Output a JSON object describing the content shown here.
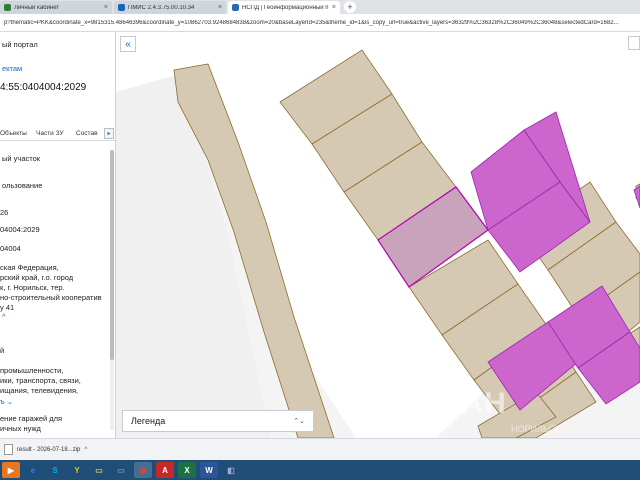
{
  "browser": {
    "tabs": [
      {
        "label": "Личный кабинет",
        "favicon_color": "#2e7d32",
        "active": false
      },
      {
        "label": "ПМИС 2.4.3.75.00.10.34",
        "favicon_color": "#1565c0",
        "active": false
      },
      {
        "label": "НСПД | Геоинформационный п",
        "favicon_color": "#2b6cb0",
        "active": true
      }
    ],
    "new_tab_glyph": "+",
    "close_glyph": "×",
    "address": "p?thematic=PKK&coordinate_x=9815315.48646396&coordinate_y=10862703.9248684838&zoom=20&baseLayerId=235&theme_id=1&is_copy_url=true&active_layers=36329%2C36328%2C36049%2C36048&selectedCard=1682..."
  },
  "panel": {
    "portal_title": "ый портал",
    "layers_link": "ектам",
    "cadastral_number": "4:55:0404004:2029",
    "subtabs": [
      "Объекты",
      "Части ЗУ",
      "Состав"
    ],
    "subtab_arrow": "▸",
    "lines": [
      {
        "text": "ый участок",
        "style": "normal"
      },
      {
        "text": "ользование",
        "style": "normal"
      },
      {
        "text": "26",
        "style": "normal"
      },
      {
        "text": "04004:2029",
        "style": "normal"
      },
      {
        "text": "04004",
        "style": "normal"
      },
      {
        "text": "ская Федерация,",
        "style": "normal"
      },
      {
        "text": "рский край, г.о. город",
        "style": "normal"
      },
      {
        "text": "к, г. Норильск, тер.",
        "style": "normal"
      },
      {
        "text": "но-строительный кооператив",
        "style": "normal"
      },
      {
        "text": "у 41",
        "style": "normal"
      },
      {
        "text": "^",
        "style": "link"
      },
      {
        "text": "й",
        "style": "normal"
      },
      {
        "text": "промышленности,",
        "style": "normal"
      },
      {
        "text": "ики, транспорта, связи,",
        "style": "normal"
      },
      {
        "text": "ищания, телевидения,",
        "style": "normal"
      },
      {
        "text": "ъ ⌄",
        "style": "link"
      },
      {
        "text": "ение гаражей для",
        "style": "normal"
      },
      {
        "text": "ичных нужд",
        "style": "normal"
      }
    ]
  },
  "map": {
    "collapse_glyph": "«",
    "legend_label": "Легенда",
    "legend_caret": "⌃⌄",
    "watermark": "ЦИАН",
    "watermark_sub": "НОРИЛЬСК",
    "colors": {
      "parcel_fill": "#d6c9b3",
      "parcel_stroke": "#8a6d2e",
      "selected_fill": "#c9a2bb",
      "selected_stroke": "#b000b5",
      "magenta_fill": "#cc66cc",
      "background": "#f4f4f4"
    }
  },
  "downloads": {
    "filename": "result - 2026-07-18...zip",
    "caret": "^"
  },
  "taskbar": {
    "items": [
      {
        "name": "start-button",
        "glyph": "▶",
        "color": "#e87722"
      },
      {
        "name": "explorer",
        "glyph": "e",
        "color": "#3b7dd8"
      },
      {
        "name": "skype",
        "glyph": "S",
        "color": "#00aff0"
      },
      {
        "name": "yandex",
        "glyph": "Y",
        "color": "#f0c419"
      },
      {
        "name": "folder",
        "glyph": "▭",
        "color": "#e8b84a"
      },
      {
        "name": "window",
        "glyph": "▭",
        "color": "#6a8fb8"
      },
      {
        "name": "chrome",
        "glyph": "◉",
        "color": "#db4437"
      },
      {
        "name": "pdf",
        "glyph": "A",
        "color": "#c62828"
      },
      {
        "name": "excel",
        "glyph": "X",
        "color": "#1d7044"
      },
      {
        "name": "word",
        "glyph": "W",
        "color": "#2b579a"
      },
      {
        "name": "other",
        "glyph": "◧",
        "color": "#5c6bc0"
      }
    ]
  }
}
